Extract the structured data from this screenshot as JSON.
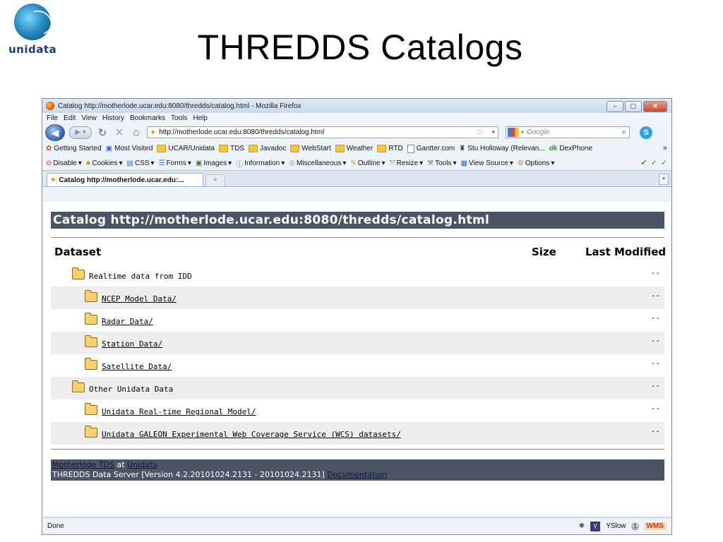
{
  "slide": {
    "logo_text": "unidata",
    "title": "THREDDS Catalogs"
  },
  "window": {
    "title": "Catalog http://motherlode.ucar.edu:8080/thredds/catalog.html - Mozilla Firefox",
    "controls": [
      "‒",
      "▢",
      "✕"
    ]
  },
  "menu": [
    "File",
    "Edit",
    "View",
    "History",
    "Bookmarks",
    "Tools",
    "Help"
  ],
  "nav": {
    "url": "http://motherlode.ucar.edu:8080/thredds/catalog.html",
    "search_placeholder": "Google"
  },
  "bookmarks": [
    {
      "label": "Getting Started",
      "icon": "firefox-icon"
    },
    {
      "label": "Most Visited",
      "icon": "page-icon"
    },
    {
      "label": "UCAR/Unidata",
      "icon": "folder-icon"
    },
    {
      "label": "TDS",
      "icon": "folder-icon"
    },
    {
      "label": "Javadoc",
      "icon": "folder-icon"
    },
    {
      "label": "WebStart",
      "icon": "folder-icon"
    },
    {
      "label": "Weather",
      "icon": "folder-icon"
    },
    {
      "label": "RTD",
      "icon": "folder-icon"
    },
    {
      "label": "Gantter.com",
      "icon": "page-icon"
    },
    {
      "label": "Stu Holloway (Relevan...",
      "icon": "user-icon"
    },
    {
      "label": "DexPhone",
      "icon": "dk-icon"
    }
  ],
  "devbar": [
    {
      "label": "Disable",
      "icon": "disable-icon"
    },
    {
      "label": "Cookies",
      "icon": "cookie-icon"
    },
    {
      "label": "CSS",
      "icon": "css-icon"
    },
    {
      "label": "Forms",
      "icon": "forms-icon"
    },
    {
      "label": "Images",
      "icon": "images-icon"
    },
    {
      "label": "Information",
      "icon": "info-icon"
    },
    {
      "label": "Miscellaneous",
      "icon": "misc-icon"
    },
    {
      "label": "Outline",
      "icon": "outline-icon"
    },
    {
      "label": "Resize",
      "icon": "resize-icon"
    },
    {
      "label": "Tools",
      "icon": "tools-icon"
    },
    {
      "label": "View Source",
      "icon": "source-icon"
    },
    {
      "label": "Options",
      "icon": "options-icon"
    }
  ],
  "tab": {
    "label": "Catalog http://motherlode.ucar.edu:..."
  },
  "catalog": {
    "header": "Catalog http://motherlode.ucar.edu:8080/thredds/catalog.html",
    "columns": {
      "dataset": "Dataset",
      "size": "Size",
      "modified": "Last Modified"
    },
    "rows": [
      {
        "label": "Realtime data from IDD",
        "level": 0,
        "link": false,
        "modified": "--"
      },
      {
        "label": "NCEP Model Data/",
        "level": 1,
        "link": true,
        "modified": "--"
      },
      {
        "label": "Radar Data/",
        "level": 1,
        "link": true,
        "modified": "--"
      },
      {
        "label": "Station Data/",
        "level": 1,
        "link": true,
        "modified": "--"
      },
      {
        "label": "Satellite Data/",
        "level": 1,
        "link": true,
        "modified": "--"
      },
      {
        "label": "Other Unidata Data",
        "level": 0,
        "link": false,
        "modified": "--"
      },
      {
        "label": "Unidata Real-time Regional Model/",
        "level": 1,
        "link": true,
        "modified": "--"
      },
      {
        "label": "Unidata GALEON Experimental Web Coverage Service (WCS) datasets/",
        "level": 1,
        "link": true,
        "modified": "--"
      }
    ],
    "footer": {
      "tds_link": "Motherlode TDS",
      "at": " at ",
      "unidata_link": "Unidata",
      "version": "THREDDS Data Server [Version 4.2.20101024.2131 - 20101024.2131] ",
      "doc_link": "Documentation"
    }
  },
  "status": {
    "text": "Done",
    "yslow": "YSlow",
    "wms": "WMS"
  },
  "colors": {
    "header_bg": "#4c5566",
    "alt_row": "#eeeeee",
    "window_border": "#6b8fb4"
  }
}
